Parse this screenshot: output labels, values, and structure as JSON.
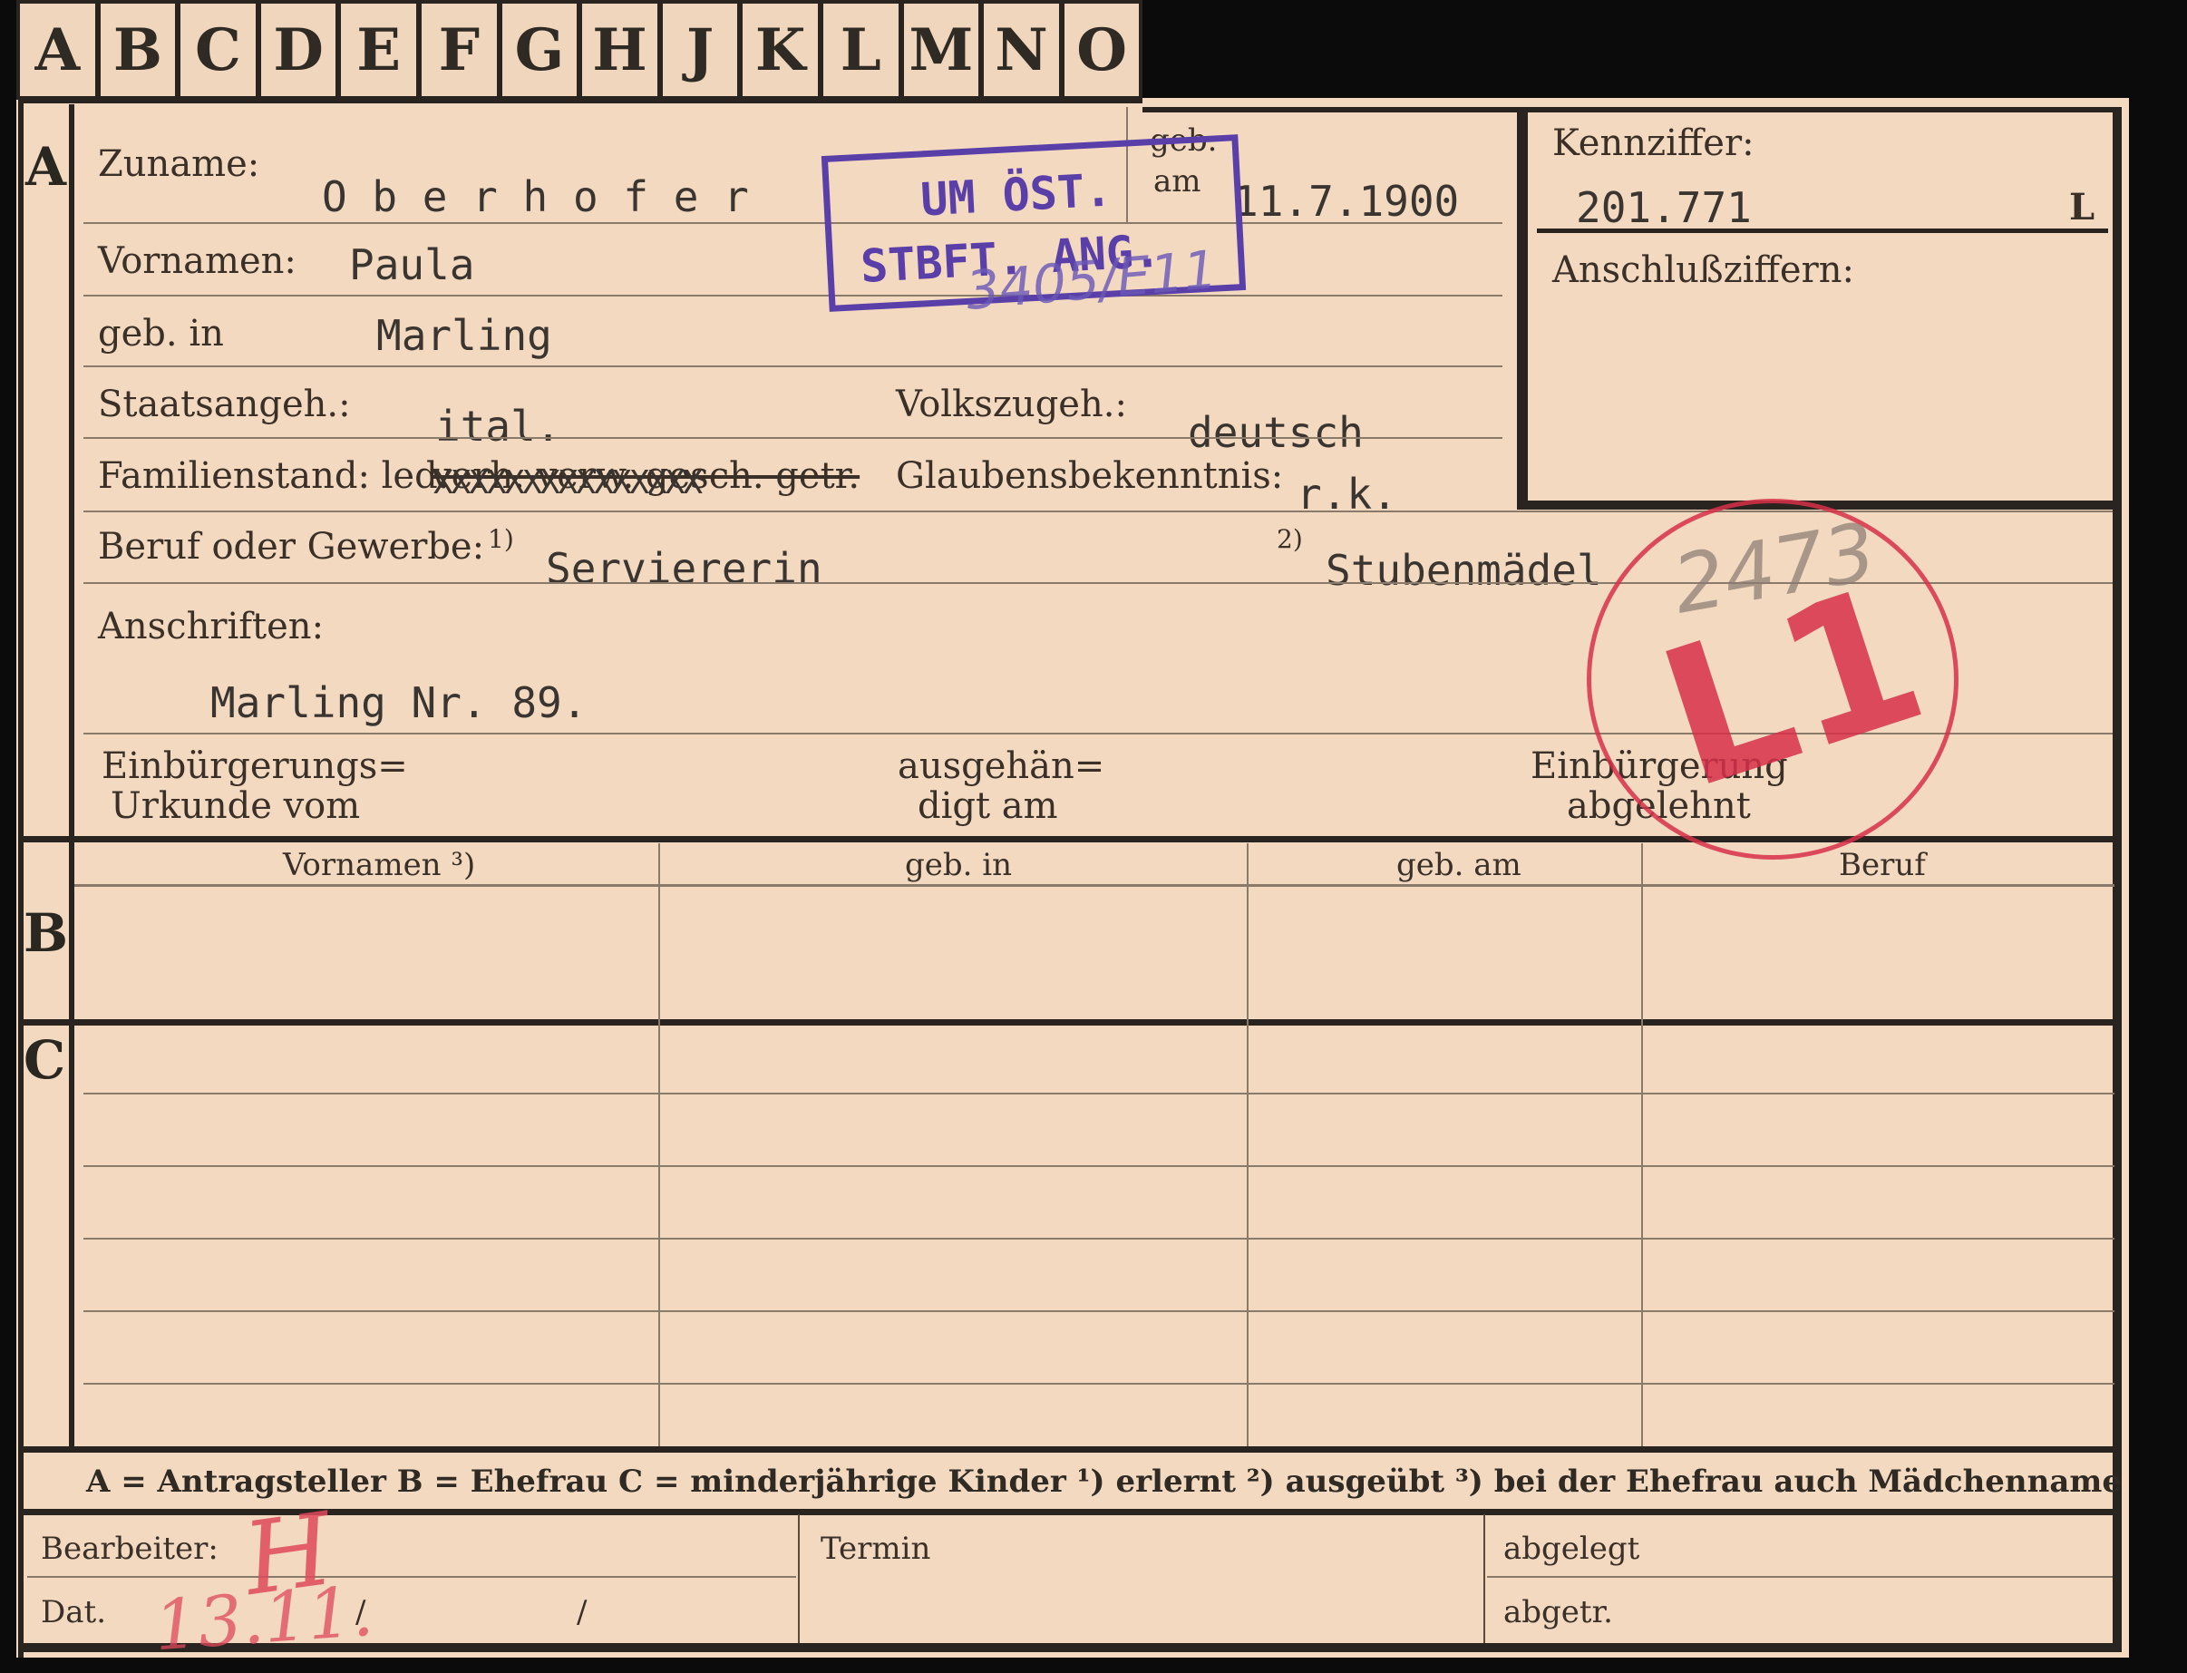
{
  "tabs": [
    "A",
    "B",
    "C",
    "D",
    "E",
    "F",
    "G",
    "H",
    "J",
    "K",
    "L",
    "M",
    "N",
    "O"
  ],
  "section_letters": {
    "a": "A",
    "b": "B",
    "c": "C"
  },
  "fields": {
    "zuname_label": "Zuname:",
    "zuname_value": "O b e r h o f e r",
    "geb_am_label_1": "geb.",
    "geb_am_label_2": "am",
    "geb_am_value": "11.7.1900",
    "vornamen_label": "Vornamen:",
    "vornamen_value": "Paula",
    "geb_in_label": "geb. in",
    "geb_in_value": "Marling",
    "staatsangeh_label": "Staatsangeh.:",
    "staatsangeh_value": "ital.",
    "volkszugeh_label": "Volkszugeh.:",
    "volkszugeh_value": "deutsch",
    "familienstand_label": "Familienstand: led.",
    "familienstand_struck": "verh. verw. gesch. getr.",
    "familienstand_x": "XXXXXXXXXXXXXXX",
    "glaubens_label": "Glaubensbekenntnis:",
    "glaubens_value": "r.k.",
    "beruf_label": "Beruf oder Gewerbe:",
    "beruf_sup1": "1)",
    "beruf_value1": "Serviererin",
    "beruf_sup2": "2)",
    "beruf_value2": "Stubenmädel",
    "anschriften_label": "Anschriften:",
    "anschriften_value": "Marling Nr. 89.",
    "einb_urkunde_l1": "Einbürgerungs=",
    "einb_urkunde_l2": "Urkunde vom",
    "ausgehaen_l1": "ausgehän=",
    "ausgehaen_l2": "digt am",
    "einb_abgelehnt_l1": "Einbürgerung",
    "einb_abgelehnt_l2": "abgelehnt"
  },
  "kennziffer": {
    "label": "Kennziffer:",
    "value": "201.771",
    "suffix": "L",
    "anschluss_label": "Anschlußziffern:"
  },
  "stamp_box": {
    "line1": "UM ÖST.",
    "line2": "STBFT. ANG.",
    "handwritten": "3405/E11"
  },
  "stamp_circle": {
    "text": "L1",
    "handwritten": "2473"
  },
  "table_headers": [
    "Vornamen ³)",
    "geb. in",
    "geb. am",
    "Beruf"
  ],
  "legend": "A = Antragsteller   B = Ehefrau   C = minderjährige Kinder   ¹) erlernt   ²) ausgeübt   ³) bei der Ehefrau auch Mädchenname",
  "footer": {
    "bearbeiter_label": "Bearbeiter:",
    "dat_label": "Dat.",
    "dat_sep1": "/",
    "dat_sep2": "/",
    "termin_label": "Termin",
    "abgelegt_label": "abgelegt",
    "abgetr_label": "abgetr.",
    "handwritten_initial": "H",
    "handwritten_date": "13.11."
  },
  "colors": {
    "paper": "#f2d9c0",
    "ink": "#3a3028",
    "stamp_blue": "#5a3fa8",
    "stamp_red": "#d8304a"
  }
}
